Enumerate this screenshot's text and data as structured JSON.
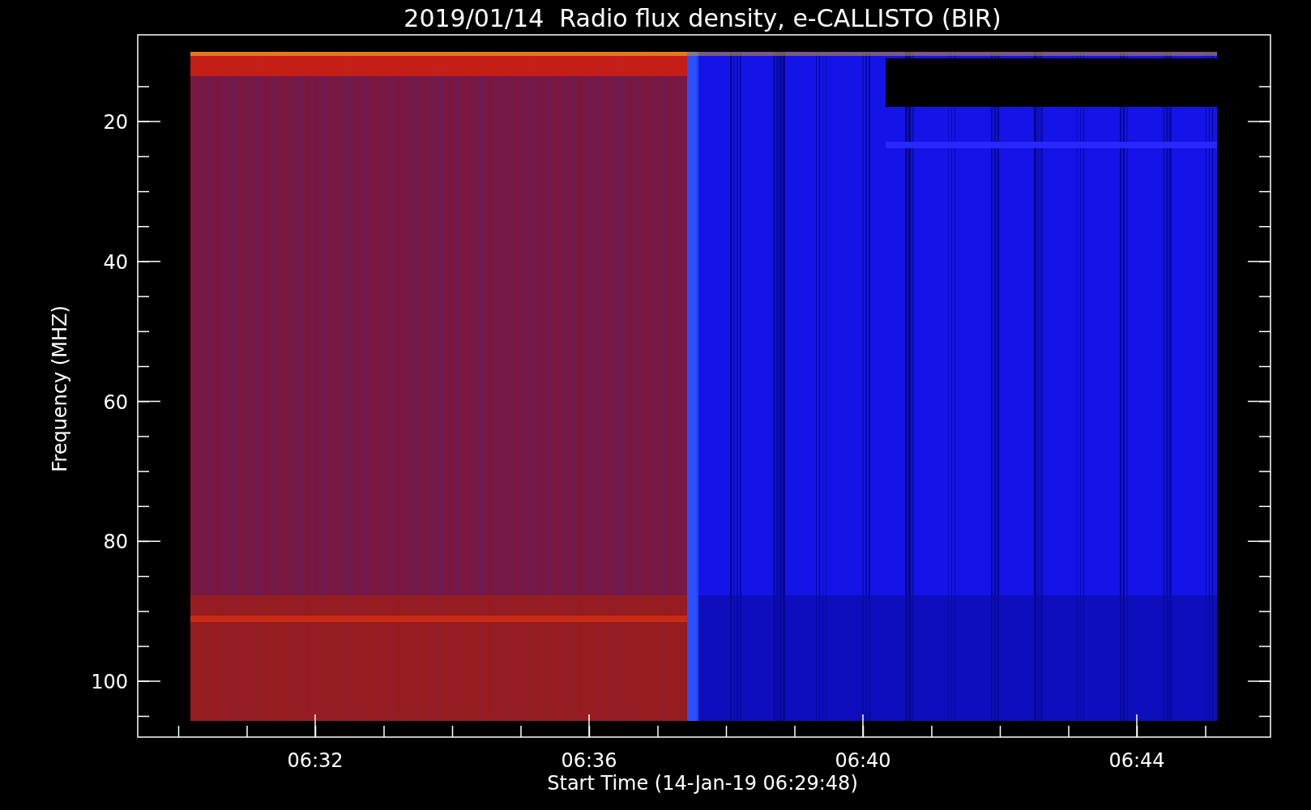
{
  "title": "2019/01/14  Radio flux density, e-CALLISTO (BIR)",
  "y_axis": {
    "label": "Frequency (MHZ)",
    "ticks": [
      "20",
      "40",
      "60",
      "80",
      "100"
    ]
  },
  "x_axis": {
    "label": "Start Time (14-Jan-19 06:29:48)",
    "ticks": [
      "06:32",
      "06:36",
      "06:40",
      "06:44"
    ]
  }
}
